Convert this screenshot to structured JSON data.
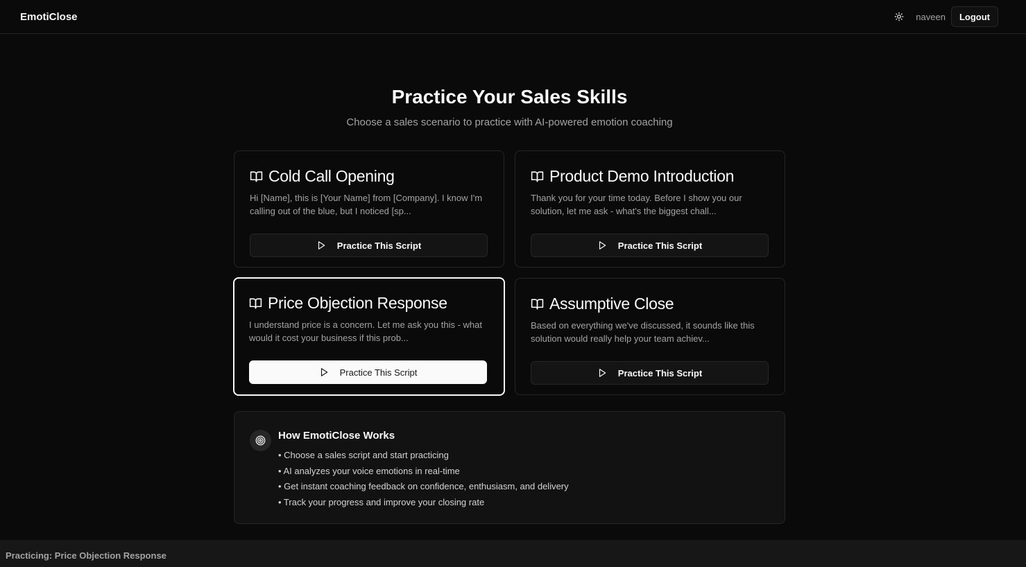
{
  "app": {
    "brand": "EmotiClose"
  },
  "header": {
    "theme_icon": "sun-icon",
    "username": "naveen",
    "logout_label": "Logout"
  },
  "hero": {
    "title": "Practice Your Sales Skills",
    "subtitle": "Choose a sales scenario to practice with AI-powered emotion coaching"
  },
  "scripts": [
    {
      "title": "Cold Call Opening",
      "description": "Hi [Name], this is [Your Name] from [Company]. I know I'm calling out of the blue, but I noticed [sp...",
      "button_label": "Practice This Script",
      "selected": false
    },
    {
      "title": "Product Demo Introduction",
      "description": "Thank you for your time today. Before I show you our solution, let me ask - what's the biggest chall...",
      "button_label": "Practice This Script",
      "selected": false
    },
    {
      "title": "Price Objection Response",
      "description": "I understand price is a concern. Let me ask you this - what would it cost your business if this prob...",
      "button_label": "Practice This Script",
      "selected": true
    },
    {
      "title": "Assumptive Close",
      "description": "Based on everything we've discussed, it sounds like this solution would really help your team achiev...",
      "button_label": "Practice This Script",
      "selected": false
    }
  ],
  "how_it_works": {
    "title": "How EmotiClose Works",
    "icon": "target-icon",
    "items": [
      "• Choose a sales script and start practicing",
      "• AI analyzes your voice emotions in real-time",
      "• Get instant coaching feedback on confidence, enthusiasm, and delivery",
      "• Track your progress and improve your closing rate"
    ]
  },
  "status": {
    "text": "Practicing: Price Objection Response"
  },
  "colors": {
    "background": "#0a0a0a",
    "border": "#262626",
    "text": "#fafafa",
    "muted": "#a3a3a3",
    "selected": "#fafafa"
  }
}
